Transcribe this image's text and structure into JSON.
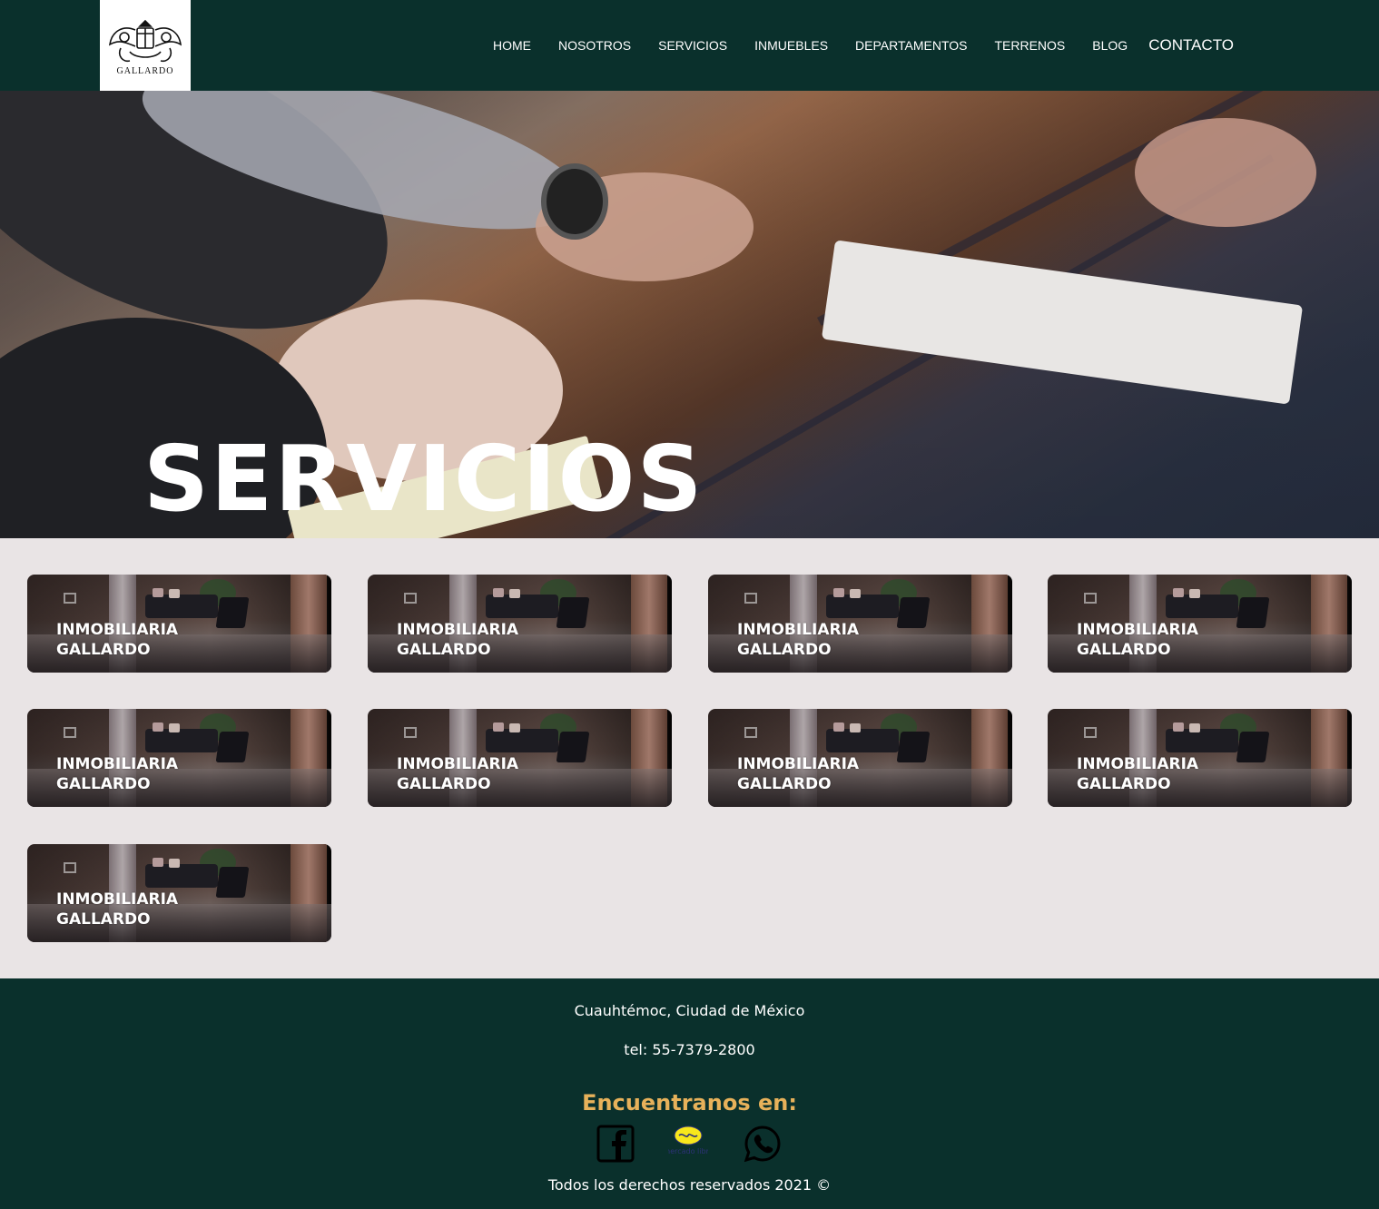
{
  "header": {
    "logo_text": "GALLARDO",
    "nav": [
      {
        "label": "HOME"
      },
      {
        "label": "NOSOTROS"
      },
      {
        "label": "SERVICIOS"
      },
      {
        "label": "INMUEBLES"
      },
      {
        "label": "DEPARTAMENTOS"
      },
      {
        "label": "TERRENOS"
      },
      {
        "label": "BLOG"
      },
      {
        "label": "CONTACTO"
      }
    ]
  },
  "hero": {
    "title": "SERVICIOS"
  },
  "cards": [
    {
      "title": "INMOBILIARIA GALLARDO"
    },
    {
      "title": "INMOBILIARIA GALLARDO"
    },
    {
      "title": "INMOBILIARIA GALLARDO"
    },
    {
      "title": "INMOBILIARIA GALLARDO"
    },
    {
      "title": "INMOBILIARIA GALLARDO"
    },
    {
      "title": "INMOBILIARIA GALLARDO"
    },
    {
      "title": "INMOBILIARIA GALLARDO"
    },
    {
      "title": "INMOBILIARIA GALLARDO"
    },
    {
      "title": "INMOBILIARIA GALLARDO"
    }
  ],
  "footer": {
    "address": "Cuauhtémoc, Ciudad de México",
    "tel": "tel: 55-7379-2800",
    "find_us": "Encuentranos en:",
    "social": [
      "facebook-icon",
      "mercado-libre-icon",
      "whatsapp-icon"
    ],
    "mercado_libre_text": "mercado libre",
    "copyright": "Todos los derechos reservados 2021 ©"
  },
  "colors": {
    "header_bg": "#0a302c",
    "page_bg": "#e9e4e5",
    "accent": "#e7b15a"
  }
}
